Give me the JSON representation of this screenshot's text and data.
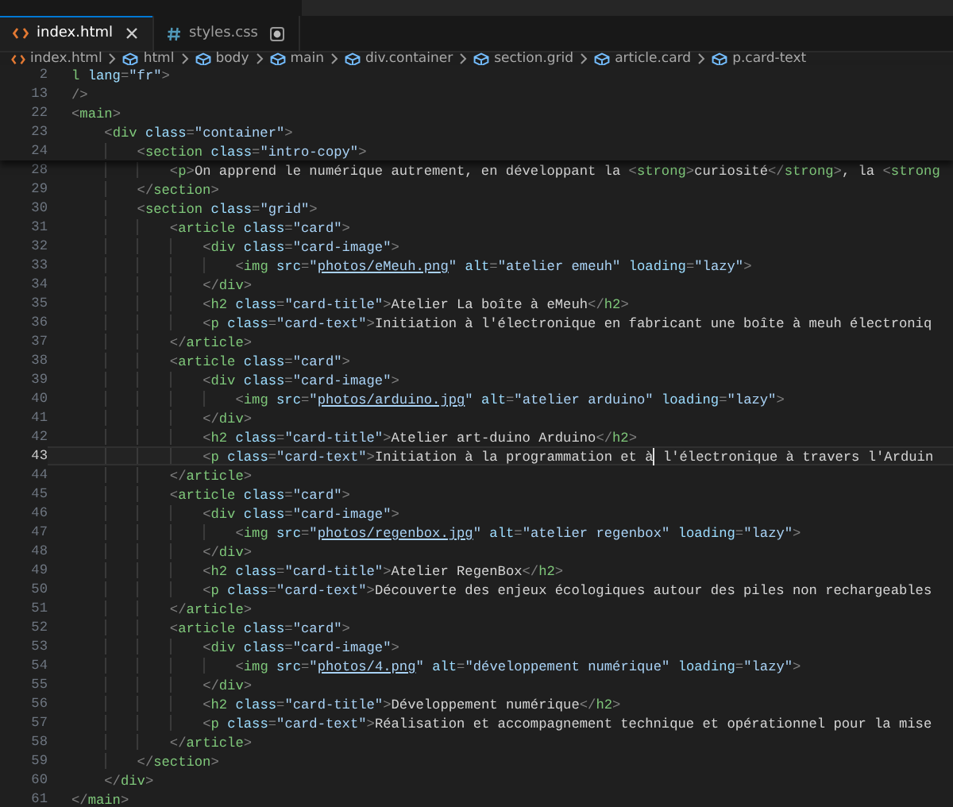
{
  "tabs": [
    {
      "label": "index.html",
      "kind": "html",
      "selected": true,
      "modified": false
    },
    {
      "label": "styles.css",
      "kind": "css",
      "selected": false,
      "modified": true
    }
  ],
  "breadcrumbs": [
    {
      "label": "index.html",
      "kind": "file"
    },
    {
      "label": "html",
      "kind": "element"
    },
    {
      "label": "body",
      "kind": "element"
    },
    {
      "label": "main",
      "kind": "element"
    },
    {
      "label": "div.container",
      "kind": "element"
    },
    {
      "label": "section.grid",
      "kind": "element"
    },
    {
      "label": "article.card",
      "kind": "element"
    },
    {
      "label": "p.card-text",
      "kind": "element"
    }
  ],
  "sticky_lines": [
    {
      "number": "2",
      "text": "l lang=\"fr\">"
    },
    {
      "number": "13",
      "text": "/>"
    },
    {
      "number": "22",
      "text": "<main>"
    },
    {
      "number": "23",
      "text": "    <div class=\"container\">"
    },
    {
      "number": "24",
      "text": "        <section class=\"intro-copy\">"
    }
  ],
  "lines": [
    {
      "number": "28",
      "current": false,
      "text": "            <p>On apprend le numérique autrement, en développant la <strong>curiosité</strong>, la <strong"
    },
    {
      "number": "29",
      "current": false,
      "text": "        </section>"
    },
    {
      "number": "30",
      "current": false,
      "text": "        <section class=\"grid\">"
    },
    {
      "number": "31",
      "current": false,
      "text": "            <article class=\"card\">"
    },
    {
      "number": "32",
      "current": false,
      "text": "                <div class=\"card-image\">"
    },
    {
      "number": "33",
      "current": false,
      "text": "                    <img src=\"photos/eMeuh.png\" alt=\"atelier emeuh\" loading=\"lazy\">"
    },
    {
      "number": "34",
      "current": false,
      "text": "                </div>"
    },
    {
      "number": "35",
      "current": false,
      "text": "                <h2 class=\"card-title\">Atelier La boîte à eMeuh</h2>"
    },
    {
      "number": "36",
      "current": false,
      "text": "                <p class=\"card-text\">Initiation à l'électronique en fabricant une boîte à meuh électroniq"
    },
    {
      "number": "37",
      "current": false,
      "text": "            </article>"
    },
    {
      "number": "38",
      "current": false,
      "text": "            <article class=\"card\">"
    },
    {
      "number": "39",
      "current": false,
      "text": "                <div class=\"card-image\">"
    },
    {
      "number": "40",
      "current": false,
      "text": "                    <img src=\"photos/arduino.jpg\" alt=\"atelier arduino\" loading=\"lazy\">"
    },
    {
      "number": "41",
      "current": false,
      "text": "                </div>"
    },
    {
      "number": "42",
      "current": false,
      "text": "                <h2 class=\"card-title\">Atelier art-duino Arduino</h2>"
    },
    {
      "number": "43",
      "current": true,
      "text": "                <p class=\"card-text\">Initiation à la programmation et à",
      "text_after_cursor": " l'électronique à travers l'Arduin"
    },
    {
      "number": "44",
      "current": false,
      "text": "            </article>"
    },
    {
      "number": "45",
      "current": false,
      "text": "            <article class=\"card\">"
    },
    {
      "number": "46",
      "current": false,
      "text": "                <div class=\"card-image\">"
    },
    {
      "number": "47",
      "current": false,
      "text": "                    <img src=\"photos/regenbox.jpg\" alt=\"atelier regenbox\" loading=\"lazy\">"
    },
    {
      "number": "48",
      "current": false,
      "text": "                </div>"
    },
    {
      "number": "49",
      "current": false,
      "text": "                <h2 class=\"card-title\">Atelier RegenBox</h2>"
    },
    {
      "number": "50",
      "current": false,
      "text": "                <p class=\"card-text\">Découverte des enjeux écologiques autour des piles non rechargeables"
    },
    {
      "number": "51",
      "current": false,
      "text": "            </article>"
    },
    {
      "number": "52",
      "current": false,
      "text": "            <article class=\"card\">"
    },
    {
      "number": "53",
      "current": false,
      "text": "                <div class=\"card-image\">"
    },
    {
      "number": "54",
      "current": false,
      "text": "                    <img src=\"photos/4.png\" alt=\"développement numérique\" loading=\"lazy\">"
    },
    {
      "number": "55",
      "current": false,
      "text": "                </div>"
    },
    {
      "number": "56",
      "current": false,
      "text": "                <h2 class=\"card-title\">Développement numérique</h2>"
    },
    {
      "number": "57",
      "current": false,
      "text": "                <p class=\"card-text\">Réalisation et accompagnement technique et opérationnel pour la mise"
    },
    {
      "number": "58",
      "current": false,
      "text": "            </article>"
    },
    {
      "number": "59",
      "current": false,
      "text": "        </section>"
    },
    {
      "number": "60",
      "current": false,
      "text": "    </div>"
    },
    {
      "number": "61",
      "current": false,
      "text": "</main>"
    }
  ]
}
